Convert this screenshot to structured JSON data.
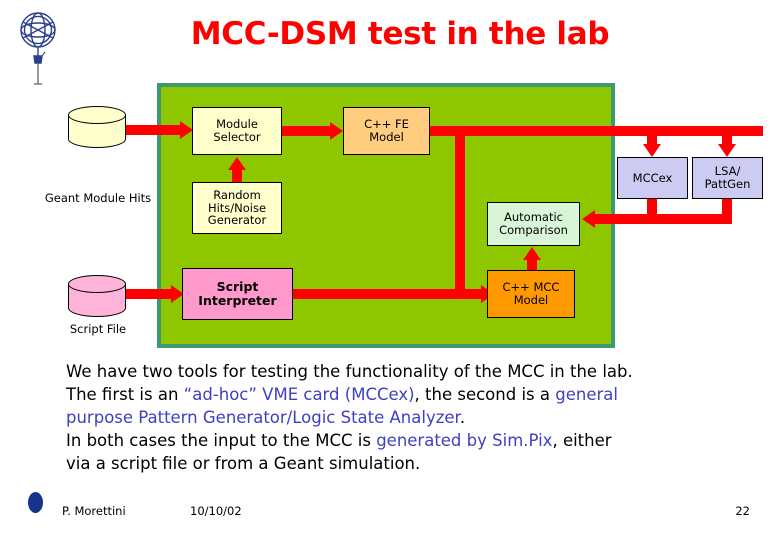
{
  "slide": {
    "title": "MCC-DSM test in the lab",
    "title_color": "#ff0000",
    "logo_name": "globe-wireframe-logo"
  },
  "diagram": {
    "panel": {
      "fill": "#8ec700",
      "border": "#3d9970"
    },
    "connector_color": "#ff0000",
    "boxes": [
      {
        "id": "module-selector",
        "label_lines": [
          "Module",
          "Selector"
        ],
        "fill": "#ffffcc"
      },
      {
        "id": "random-hits-generator",
        "label_lines": [
          "Random",
          "Hits/Noise",
          "Generator"
        ],
        "fill": "#ffffcc"
      },
      {
        "id": "cpp-fe-model",
        "label_lines": [
          "C++ FE",
          "Model"
        ],
        "fill": "#ffcc80"
      },
      {
        "id": "script-interpreter",
        "label_lines": [
          "Script",
          "Interpreter"
        ],
        "fill": "#ff99cc"
      },
      {
        "id": "automatic-comparison",
        "label_lines": [
          "Automatic",
          "Comparison"
        ],
        "fill": "#d8f5d8"
      },
      {
        "id": "cpp-mcc-model",
        "label_lines": [
          "C++ MCC",
          "Model"
        ],
        "fill": "#ff9900"
      },
      {
        "id": "mccex",
        "label_lines": [
          "MCCex"
        ],
        "fill": "#ccccf2"
      },
      {
        "id": "lsa-pattgen",
        "label_lines": [
          "LSA/",
          "PattGen"
        ],
        "fill": "#ccccf2"
      }
    ],
    "cylinders": [
      {
        "id": "geant-module-hits",
        "label_lines": [
          "Geant Module",
          "Hits"
        ],
        "fill": "#ffffcc"
      },
      {
        "id": "script-file",
        "label_lines": [
          "Script File"
        ],
        "fill": "#ffb3d9"
      }
    ]
  },
  "body": {
    "line1": "We have two tools for testing the functionality of the MCC in the lab.",
    "line2_a": "The first is an ",
    "line2_hl": "“ad-hoc” VME card (MCCex)",
    "line2_b": ", the second is a ",
    "line2_hl2": "general",
    "line3_hl": "purpose Pattern Generator/Logic State Analyzer",
    "line3_b": ".",
    "line4_a": "In both cases the input to the MCC is ",
    "line4_hl": "generated by Sim.Pix",
    "line4_b": ", either",
    "line5": "via a script file or from a Geant simulation.",
    "highlight_color": "#4040c0"
  },
  "footer": {
    "author": "P. Morettini",
    "date": "10/10/02",
    "page": "22",
    "bullet_color": "#16348c"
  }
}
